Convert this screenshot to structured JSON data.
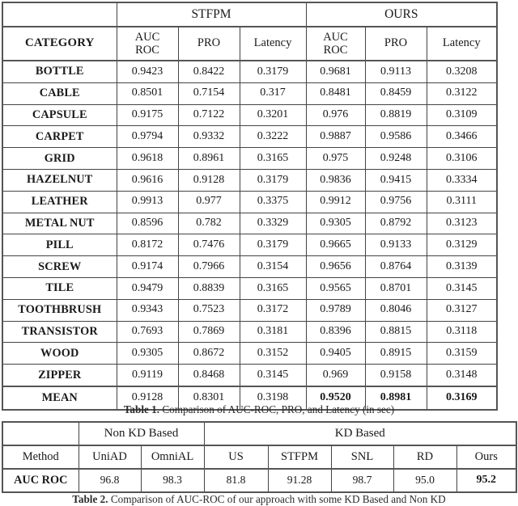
{
  "table1": {
    "group_headers": [
      "",
      "STFPM",
      "OURS"
    ],
    "column_headers": {
      "category": "CATEGORY",
      "stfpm": [
        "AUC ROC",
        "PRO",
        "Latency"
      ],
      "ours": [
        "AUC ROC",
        "PRO",
        "Latency"
      ],
      "auc_line1": "AUC",
      "auc_line2": "ROC",
      "pro": "PRO",
      "latency": "Latency"
    },
    "rows": [
      {
        "category": "BOTTLE",
        "values": [
          "0.9423",
          "0.8422",
          "0.3179",
          "0.9681",
          "0.9113",
          "0.3208"
        ]
      },
      {
        "category": "CABLE",
        "values": [
          "0.8501",
          "0.7154",
          "0.317",
          "0.8481",
          "0.8459",
          "0.3122"
        ]
      },
      {
        "category": "CAPSULE",
        "values": [
          "0.9175",
          "0.7122",
          "0.3201",
          "0.976",
          "0.8819",
          "0.3109"
        ]
      },
      {
        "category": "CARPET",
        "values": [
          "0.9794",
          "0.9332",
          "0.3222",
          "0.9887",
          "0.9586",
          "0.3466"
        ]
      },
      {
        "category": "GRID",
        "values": [
          "0.9618",
          "0.8961",
          "0.3165",
          "0.975",
          "0.9248",
          "0.3106"
        ]
      },
      {
        "category": "HAZELNUT",
        "values": [
          "0.9616",
          "0.9128",
          "0.3179",
          "0.9836",
          "0.9415",
          "0.3334"
        ]
      },
      {
        "category": "LEATHER",
        "values": [
          "0.9913",
          "0.977",
          "0.3375",
          "0.9912",
          "0.9756",
          "0.3111"
        ]
      },
      {
        "category": "METAL NUT",
        "values": [
          "0.8596",
          "0.782",
          "0.3329",
          "0.9305",
          "0.8792",
          "0.3123"
        ]
      },
      {
        "category": "PILL",
        "values": [
          "0.8172",
          "0.7476",
          "0.3179",
          "0.9665",
          "0.9133",
          "0.3129"
        ]
      },
      {
        "category": "SCREW",
        "values": [
          "0.9174",
          "0.7966",
          "0.3154",
          "0.9656",
          "0.8764",
          "0.3139"
        ]
      },
      {
        "category": "TILE",
        "values": [
          "0.9479",
          "0.8839",
          "0.3165",
          "0.9565",
          "0.8701",
          "0.3145"
        ]
      },
      {
        "category": "TOOTHBRUSH",
        "values": [
          "0.9343",
          "0.7523",
          "0.3172",
          "0.9789",
          "0.8046",
          "0.3127"
        ]
      },
      {
        "category": "TRANSISTOR",
        "values": [
          "0.7693",
          "0.7869",
          "0.3181",
          "0.8396",
          "0.8815",
          "0.3118"
        ]
      },
      {
        "category": "WOOD",
        "values": [
          "0.9305",
          "0.8672",
          "0.3152",
          "0.9405",
          "0.8915",
          "0.3159"
        ]
      },
      {
        "category": "ZIPPER",
        "values": [
          "0.9119",
          "0.8468",
          "0.3145",
          "0.969",
          "0.9158",
          "0.3148"
        ]
      }
    ],
    "mean_row": {
      "category": "MEAN",
      "values": [
        "0.9128",
        "0.8301",
        "0.3198",
        "0.9520",
        "0.8981",
        "0.3169"
      ],
      "bold_flags": [
        false,
        false,
        false,
        true,
        true,
        true
      ]
    }
  },
  "caption1": {
    "label": "Table 1.",
    "text": " Comparison of AUC-ROC, PRO, and Latency (in sec)"
  },
  "table2": {
    "group_headers": [
      "",
      "Non KD Based",
      "KD Based"
    ],
    "non_kd_label": "Non KD Based",
    "kd_label": "KD Based",
    "column_headers": [
      "Method",
      "UniAD",
      "OmniAL",
      "US",
      "STFPM",
      "SNL",
      "RD",
      "Ours"
    ],
    "row": {
      "label": "AUC ROC",
      "values": [
        "96.8",
        "98.3",
        "81.8",
        "91.28",
        "98.7",
        "95.0",
        "95.2"
      ],
      "bold_flags": [
        false,
        false,
        false,
        false,
        false,
        false,
        true
      ]
    }
  },
  "caption2": {
    "label": "Table 2.",
    "text": " Comparison of AUC-ROC of our approach with some KD Based and Non KD"
  }
}
